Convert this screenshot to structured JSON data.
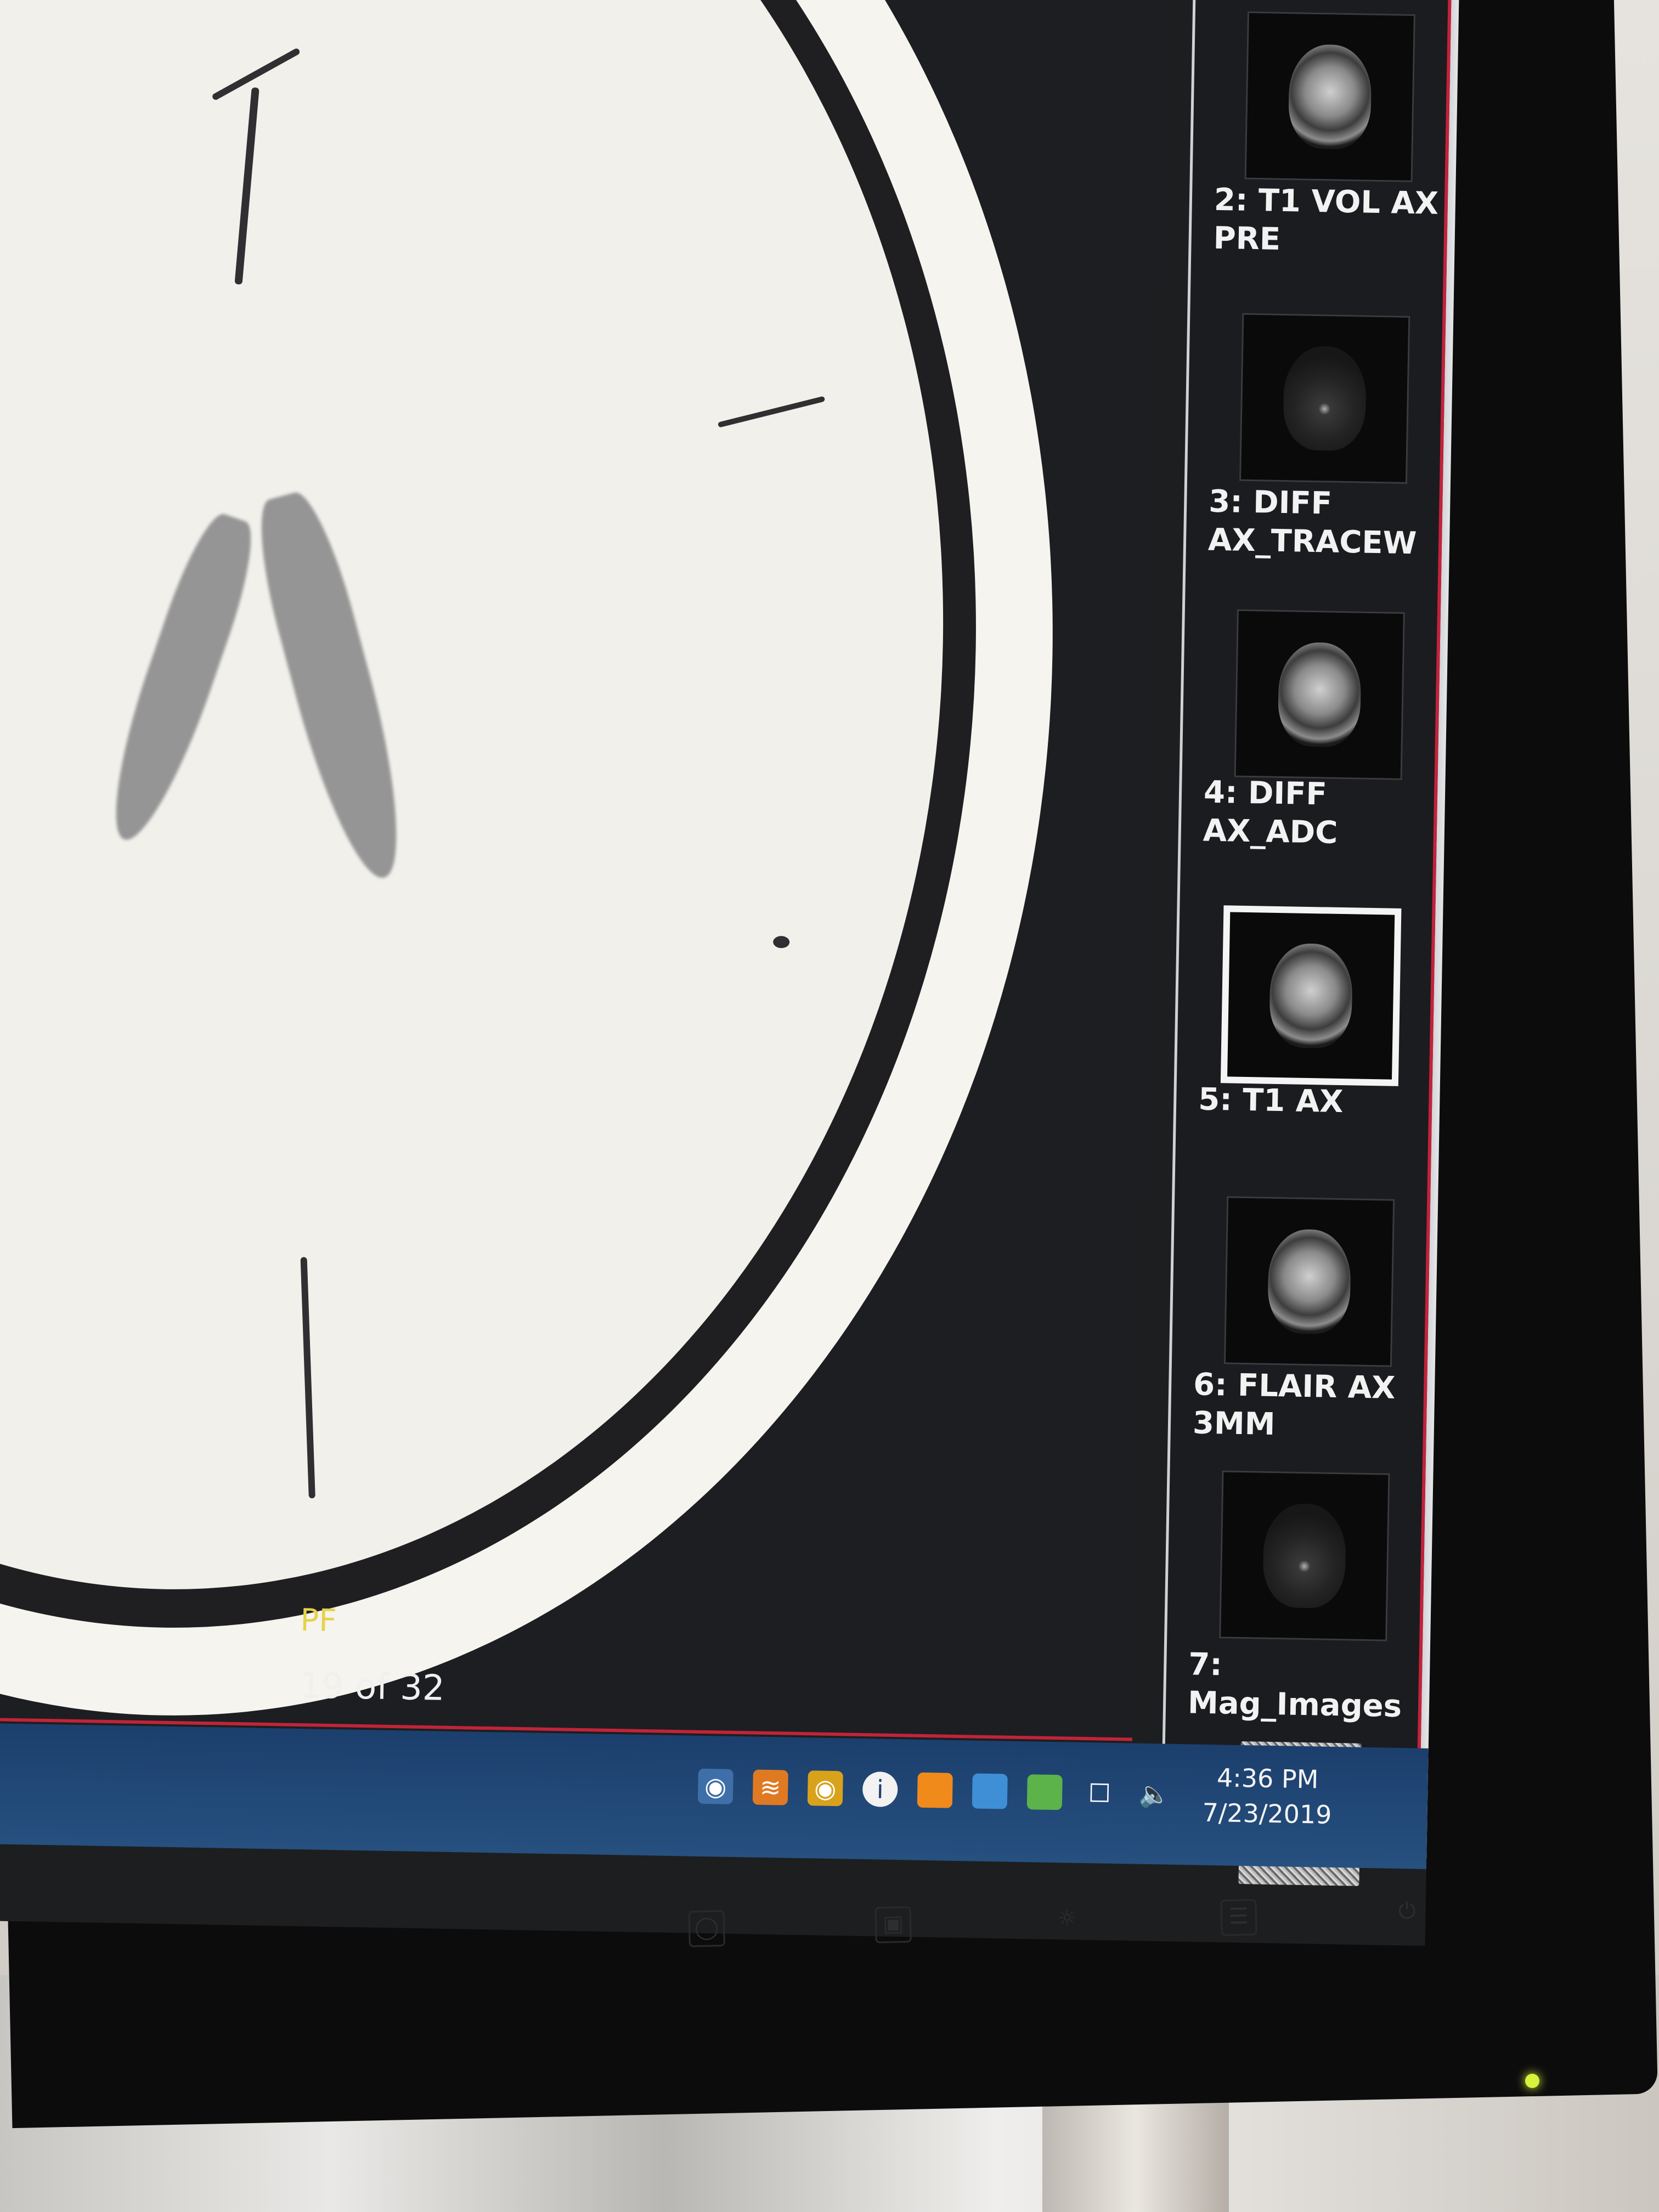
{
  "viewport": {
    "orientation_label": "PF",
    "slice_counter": "19 of 32"
  },
  "series_panel": {
    "items": [
      {
        "label": "2: T1 VOL AX PRE",
        "selected": false
      },
      {
        "label": "3: DIFF AX_TRACEW",
        "selected": false
      },
      {
        "label": "4: DIFF AX_ADC",
        "selected": false
      },
      {
        "label": "5: T1 AX",
        "selected": true
      },
      {
        "label": "6: FLAIR AX 3MM",
        "selected": false
      },
      {
        "label": "7: Mag_Images",
        "selected": false
      }
    ],
    "scroll_icon": "chevron-down-icon"
  },
  "taskbar": {
    "time": "4:36 PM",
    "date": "7/23/2019",
    "tray_icons": [
      "network-icon",
      "rss-icon",
      "security-icon",
      "info-icon",
      "orange-app-icon",
      "blue-app-icon",
      "green-app-icon",
      "connection-icon",
      "volume-icon"
    ]
  },
  "colors": {
    "orientation_label": "#e6d24a",
    "selection_border": "#f4f4f4",
    "taskbar": "#1c3f6d",
    "screen_edge_red": "#c3223b",
    "power_led": "#d7f33a"
  }
}
